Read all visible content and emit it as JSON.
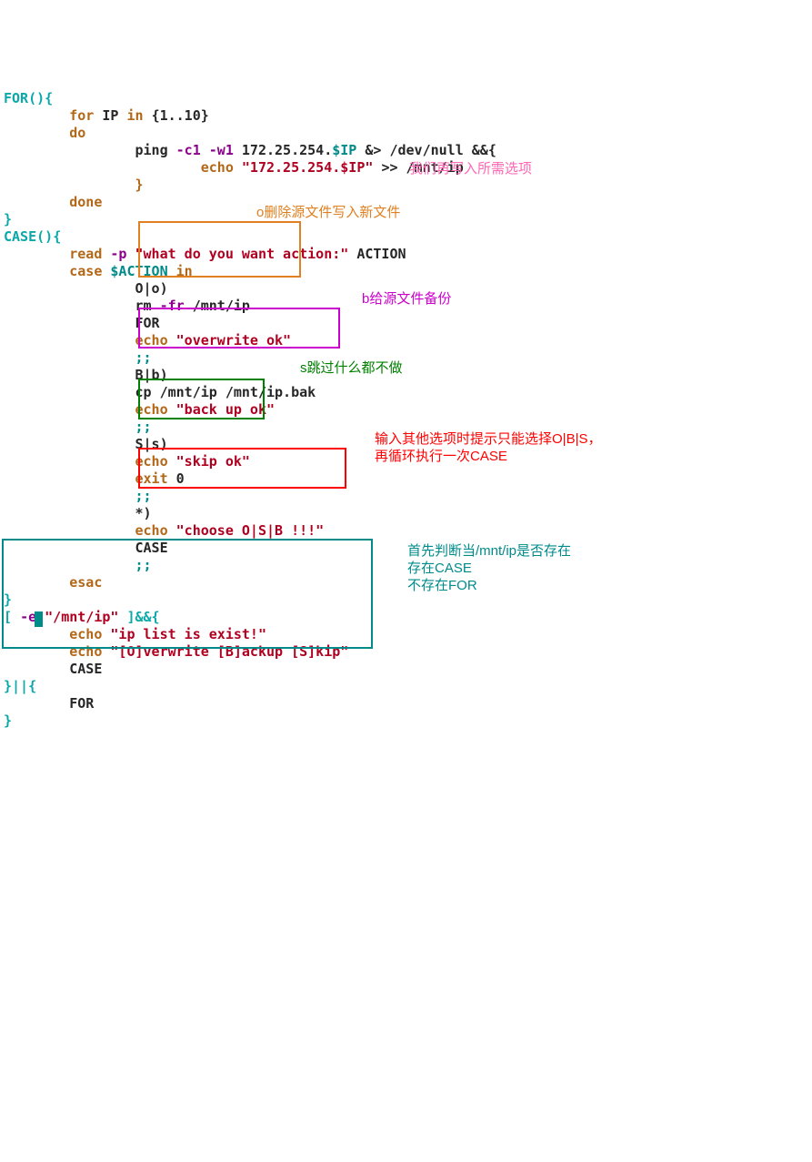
{
  "code": {
    "l1_func": "FOR()",
    "l1_brace": "{",
    "l2_for": "for",
    "l2_ip": "IP",
    "l2_in": "in",
    "l2_range": "{1..10}",
    "l3_do": "do",
    "l4_ping": "ping",
    "l4_opts": "-c1 -w1",
    "l4_host": "172.25.254.",
    "l4_var": "$IP",
    "l4_redir": "&> /dev/null &&{",
    "l5_echo": "echo",
    "l5_str": "\"172.25.254.$IP\"",
    "l5_app": ">> /mnt/ip",
    "l6_brace": "}",
    "l7_done": "done",
    "l8_brace": "}",
    "l9_case": "CASE()",
    "l9_brace": "{",
    "l10_read": "read",
    "l10_p": "-p",
    "l10_str": "\"what do you want action:\"",
    "l10_var": "ACTION",
    "l11_case": "case",
    "l11_var": "$ACTION",
    "l11_in": "in",
    "l12_pat": "O|o)",
    "l13_rm": "rm",
    "l13_opt": "-fr",
    "l13_path": "/mnt/ip",
    "l14_for": "FOR",
    "l15_echo": "echo",
    "l15_str": "\"overwrite ok\"",
    "l16_dsemi": ";;",
    "l17_pat": "B|b)",
    "l18_cp": "cp /mnt/ip /mnt/ip.bak",
    "l19_echo": "echo",
    "l19_str": "\"back up ok\"",
    "l20_dsemi": ";;",
    "l21_pat": "S|s)",
    "l22_echo": "echo",
    "l22_str": "\"skip ok\"",
    "l23_exit": "exit",
    "l23_code": "0",
    "l24_dsemi": ";;",
    "l25_pat": "*)",
    "l26_echo": "echo",
    "l26_str": "\"choose O|S|B !!!\"",
    "l27_case": "CASE",
    "l28_dsemi": ";;",
    "l29_esac": "esac",
    "l30_brace": "}",
    "l31_test": "[",
    "l31_e": "-e",
    "l31_path": "\"/mnt/ip\"",
    "l31_end": "]&&{",
    "l32_echo": "echo",
    "l32_str": "\"ip list is exist!\"",
    "l33_echo": "echo",
    "l33_str": "\"[O]verwrite [B]ackup [S]kip\"",
    "l34_case": "CASE",
    "l35_or": "}||{",
    "l36_for": "FOR",
    "l37_brace": "}"
  },
  "annotations": {
    "intro": "我们再写入所需选项",
    "o_note": "o删除源文件写入新文件",
    "b_note": "b给源文件备份",
    "s_note": "s跳过什么都不做",
    "star_note1": "输入其他选项时提示只能选择O|B|S，",
    "star_note2": "再循环执行一次CASE",
    "bottom1": "首先判断当/mnt/ip是否存在",
    "bottom2": "存在CASE",
    "bottom3": "不存在FOR"
  }
}
